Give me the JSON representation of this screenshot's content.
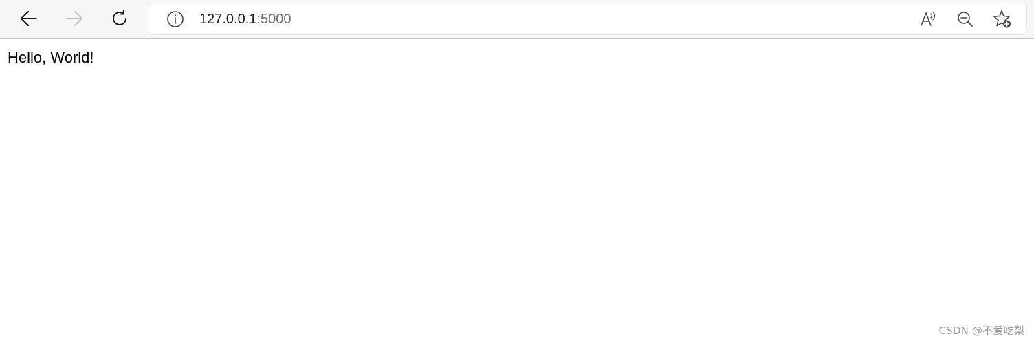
{
  "browser": {
    "url_host": "127.0.0.1",
    "url_port": ":5000",
    "icons": {
      "back": "arrow-left-icon",
      "forward": "arrow-right-icon",
      "refresh": "refresh-icon",
      "site_info": "info-icon",
      "read_aloud": "read-aloud-icon",
      "zoom_out": "zoom-out-icon",
      "favorite": "add-favorite-icon"
    }
  },
  "page": {
    "body_text": "Hello, World!"
  },
  "watermark": {
    "text": "CSDN @不爱吃梨"
  }
}
